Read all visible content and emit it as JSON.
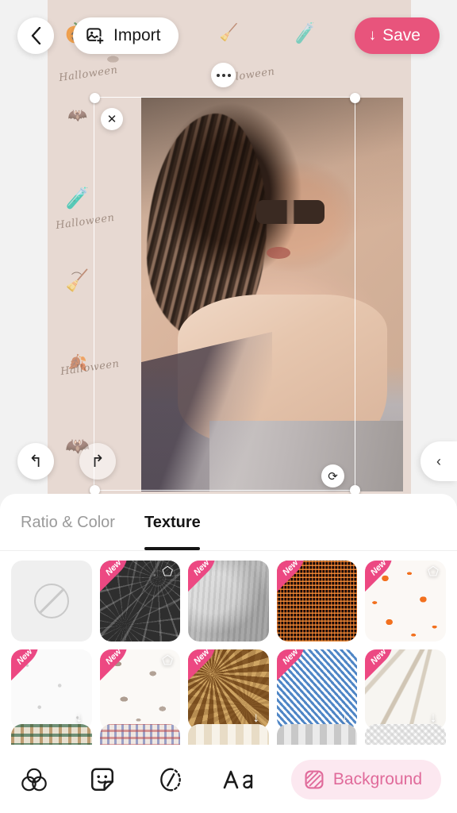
{
  "app": {
    "theme_accent": "#e8547c",
    "active_tool_color": "#e06a9a",
    "active_tool_bg": "#fce8f0"
  },
  "topbar": {
    "back_icon": "chevron-left-icon",
    "import_label": "Import",
    "import_icon": "image-plus-icon",
    "save_label": "Save",
    "save_arrow": "↓"
  },
  "canvas": {
    "background_name": "halloween-toile-pattern",
    "background_color": "#e7d9d2",
    "pattern_script_text": "Halloween",
    "pattern_glyphs": [
      "🎃",
      "🐈",
      "🧹",
      "🧪",
      "🍂",
      "🦇",
      "🎃",
      "🐈",
      "🧹",
      "🍂",
      "🧪",
      "🦇",
      "🎃",
      "🐈",
      "🍂",
      "🧹",
      "🎃",
      "🧪",
      "🐈",
      "🦇",
      "🍂",
      "🎃",
      "🧹",
      "🐈",
      "🧪",
      "🦇",
      "🎃",
      "🍂",
      "🐈",
      "🧹",
      "🎃",
      "🧪",
      "🐈",
      "🦇",
      "🍂",
      "🧹",
      "🎃",
      "🐈",
      "🧪",
      "🍂"
    ],
    "close_icon": "close-icon",
    "more_icon": "more-dots-icon",
    "rotate_icon": "rotate-icon",
    "undo_icon": "undo-arrow-icon",
    "redo_icon": "redo-arrow-icon",
    "side_tab_icon": "chevron-left-icon"
  },
  "sheet": {
    "tabs": [
      {
        "label": "Ratio & Color",
        "active": false
      },
      {
        "label": "Texture",
        "active": true
      }
    ],
    "textures": [
      {
        "name": "none",
        "new": false,
        "badge": "",
        "fill": "none"
      },
      {
        "name": "spiderweb",
        "new": true,
        "badge": "gem",
        "fill": "tx-web"
      },
      {
        "name": "concrete",
        "new": true,
        "badge": "",
        "fill": "tx-concrete"
      },
      {
        "name": "led-grid",
        "new": true,
        "badge": "",
        "fill": "tx-led"
      },
      {
        "name": "pumpkin-faces",
        "new": true,
        "badge": "gem",
        "fill": "tx-pumpkin"
      },
      {
        "name": "dotted-icons",
        "new": true,
        "badge": "download",
        "fill": "tx-dots"
      },
      {
        "name": "halloween-toile",
        "new": true,
        "badge": "gem",
        "fill": "tx-toile"
      },
      {
        "name": "brown-leather",
        "new": true,
        "badge": "download",
        "fill": "tx-leather"
      },
      {
        "name": "blue-denim",
        "new": true,
        "badge": "download",
        "fill": "tx-denim"
      },
      {
        "name": "wheat-pampas",
        "new": true,
        "badge": "download",
        "fill": "tx-wheat"
      }
    ],
    "textures_row3": [
      {
        "name": "green-plaid",
        "fill": "tx-plaid1"
      },
      {
        "name": "red-blue-plaid",
        "fill": "tx-plaid2"
      },
      {
        "name": "beige-stripes",
        "fill": "tx-beige"
      },
      {
        "name": "gray-stripes",
        "fill": "tx-gray"
      },
      {
        "name": "white-weave",
        "fill": "tx-weave"
      }
    ],
    "new_ribbon_label": "New",
    "download_glyph": "↓",
    "gem_glyph": "⬠"
  },
  "toolbar": {
    "tools": [
      {
        "name": "filter-icon",
        "label": "Filter"
      },
      {
        "name": "sticker-icon",
        "label": "Sticker"
      },
      {
        "name": "cutout-icon",
        "label": "Cutout"
      },
      {
        "name": "text-icon",
        "label": "Text"
      }
    ],
    "background_label": "Background",
    "background_icon": "hatched-square-icon"
  }
}
